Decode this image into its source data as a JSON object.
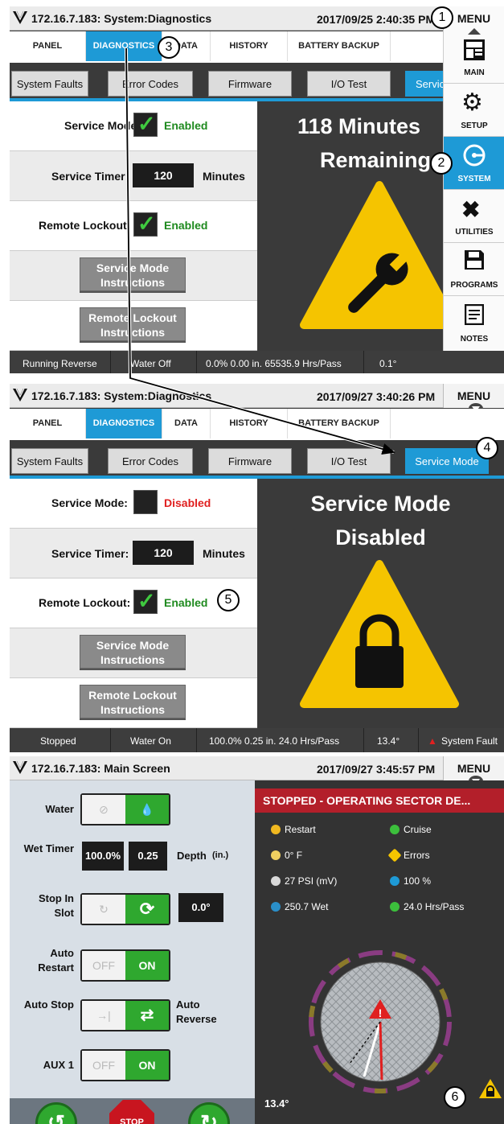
{
  "screen1": {
    "title": "172.16.7.183: System:Diagnostics",
    "datetime": "2017/09/25 2:40:35 PM",
    "menu_label": "MENU",
    "tabs": [
      "PANEL",
      "DIAGNOSTICS",
      "DATA",
      "HISTORY",
      "BATTERY BACKUP"
    ],
    "subtabs": [
      "System Faults",
      "Error Codes",
      "Firmware",
      "I/O Test",
      "Servic"
    ],
    "service_mode_label": "Service Mode:",
    "service_mode_state": "Enabled",
    "service_timer_label": "Service Timer:",
    "service_timer_value": "120",
    "service_timer_unit": "Minutes",
    "remote_lockout_label": "Remote Lockout:",
    "remote_lockout_state": "Enabled",
    "btn_service_instructions": "Service Mode Instructions",
    "btn_lockout_instructions": "Remote Lockout Instructions",
    "big_line1": "118 Minutes",
    "big_line2": "Remaining",
    "status": [
      "Running Reverse",
      "Water Off",
      "0.0%  0.00 in.  65535.9 Hrs/Pass",
      "0.1°"
    ],
    "side_menu": [
      "MAIN",
      "SETUP",
      "SYSTEM",
      "UTILITIES",
      "PROGRAMS",
      "NOTES"
    ]
  },
  "screen2": {
    "title": "172.16.7.183: System:Diagnostics",
    "datetime": "2017/09/27 3:40:26 PM",
    "menu_label": "MENU",
    "tabs": [
      "PANEL",
      "DIAGNOSTICS",
      "DATA",
      "HISTORY",
      "BATTERY BACKUP"
    ],
    "subtabs": [
      "System Faults",
      "Error Codes",
      "Firmware",
      "I/O Test",
      "Service Mode"
    ],
    "service_mode_label": "Service Mode:",
    "service_mode_state": "Disabled",
    "service_timer_label": "Service Timer:",
    "service_timer_value": "120",
    "service_timer_unit": "Minutes",
    "remote_lockout_label": "Remote Lockout:",
    "remote_lockout_state": "Enabled",
    "btn_service_instructions": "Service Mode Instructions",
    "btn_lockout_instructions": "Remote Lockout Instructions",
    "big_line1": "Service Mode",
    "big_line2": "Disabled",
    "status": [
      "Stopped",
      "Water On",
      "100.0%  0.25 in.  24.0 Hrs/Pass",
      "13.4°",
      "System Fault"
    ]
  },
  "screen3": {
    "title": "172.16.7.183: Main Screen",
    "datetime": "2017/09/27 3:45:57 PM",
    "menu_label": "MENU",
    "header": "STOPPED - OPERATING SECTOR DE...",
    "controls": {
      "water": "Water",
      "wet_timer": "Wet Timer",
      "wet_timer_value": "100.0%",
      "depth_value": "0.25",
      "depth_label": "Depth",
      "depth_unit": "(in.)",
      "stop_in_slot": "Stop In Slot",
      "stop_slot_value": "0.0°",
      "auto_restart": "Auto Restart",
      "auto_stop": "Auto Stop",
      "auto_reverse": "Auto Reverse",
      "aux1": "AUX 1",
      "off": "OFF",
      "on": "ON",
      "stop": "STOP"
    },
    "indicators": {
      "restart": "Restart",
      "cruise": "Cruise",
      "temp": "0° F",
      "errors": "Errors",
      "psi": "27 PSI (mV)",
      "percent": "100 %",
      "wet": "250.7 Wet",
      "hrs": "24.0 Hrs/Pass"
    },
    "angle": "13.4°"
  },
  "callouts": [
    "1",
    "2",
    "3",
    "4",
    "5",
    "6"
  ],
  "colors": {
    "accent": "#1e9ad6",
    "enabled": "#1f8a1f",
    "disabled": "#e02020",
    "warning": "#f5c400",
    "alarm": "#b31f2a"
  }
}
